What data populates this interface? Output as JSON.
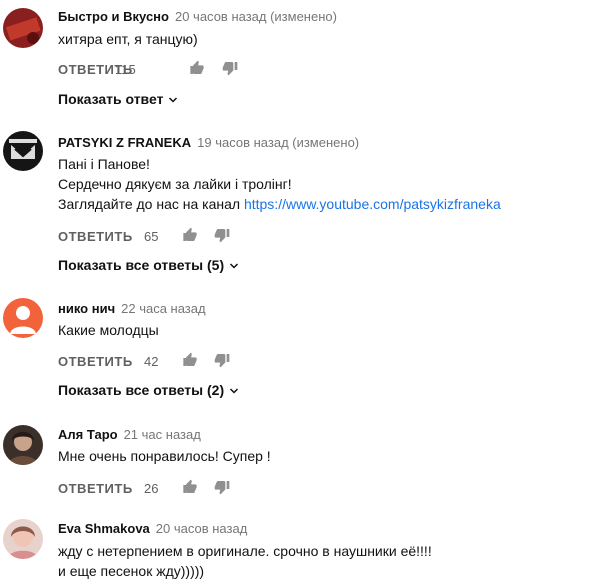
{
  "buttons": {
    "reply": "ОТВЕТИТЬ"
  },
  "colors": {
    "link": "#1a73e8",
    "meta": "#767676",
    "action": "#606060"
  },
  "comments": [
    {
      "author": "Быстро и Вкусно",
      "time": "20 часов назад (изменено)",
      "lines": [
        "хитяра епт, я танцую)"
      ],
      "likes": "115",
      "replies_label": "Показать ответ"
    },
    {
      "author": "PATSYKI Z FRANEKA",
      "time": "19 часов назад (изменено)",
      "lines": [
        "Пані і Панове!",
        "Сердечно дякуєм за лайки і тролінг!",
        "Заглядайте до нас на канал"
      ],
      "link": "https://www.youtube.com/patsykizfraneka",
      "likes": "65",
      "replies_label": "Показать все ответы (5)"
    },
    {
      "author": "нико нич",
      "time": "22 часа назад",
      "lines": [
        "Какие молодцы"
      ],
      "likes": "42",
      "replies_label": "Показать все ответы (2)"
    },
    {
      "author": "Аля Таро",
      "time": "21 час назад",
      "lines": [
        "Мне очень понравилось!  Супер !"
      ],
      "likes": "26"
    },
    {
      "author": "Eva Shmakova",
      "time": "20 часов назад",
      "lines": [
        "жду с нетерпением в оригинале. срочно в наушники её!!!!",
        "и еще песенок жду)))))"
      ]
    }
  ]
}
